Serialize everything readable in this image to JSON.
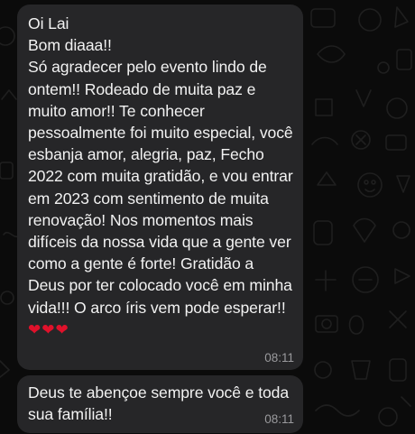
{
  "theme": {
    "background": "#0b0b0b",
    "bubble_color": "#262628",
    "text_color": "#f2f2f2",
    "time_color": "#9a9a9d",
    "heart_color": "#e0112b"
  },
  "messages": [
    {
      "text": "Oi Lai\nBom diaaa!!\nSó agradecer pelo evento lindo de ontem!! Rodeado de muita paz e muito amor!! Te conhecer pessoalmente foi muito especial, você esbanja amor, alegria, paz, Fecho 2022 com muita gratidão, e vou entrar em 2023 com sentimento de muita renovação! Nos momentos mais difíceis da nossa vida que a gente ver como a gente é forte! Gratidão a Deus por ter colocado você em minha vida!!! O arco íris vem pode esperar!!",
      "emoji": "❤❤❤",
      "time": "08:11"
    },
    {
      "text": "Deus te abençoe sempre você e toda sua família!!",
      "time": "08:11"
    }
  ]
}
